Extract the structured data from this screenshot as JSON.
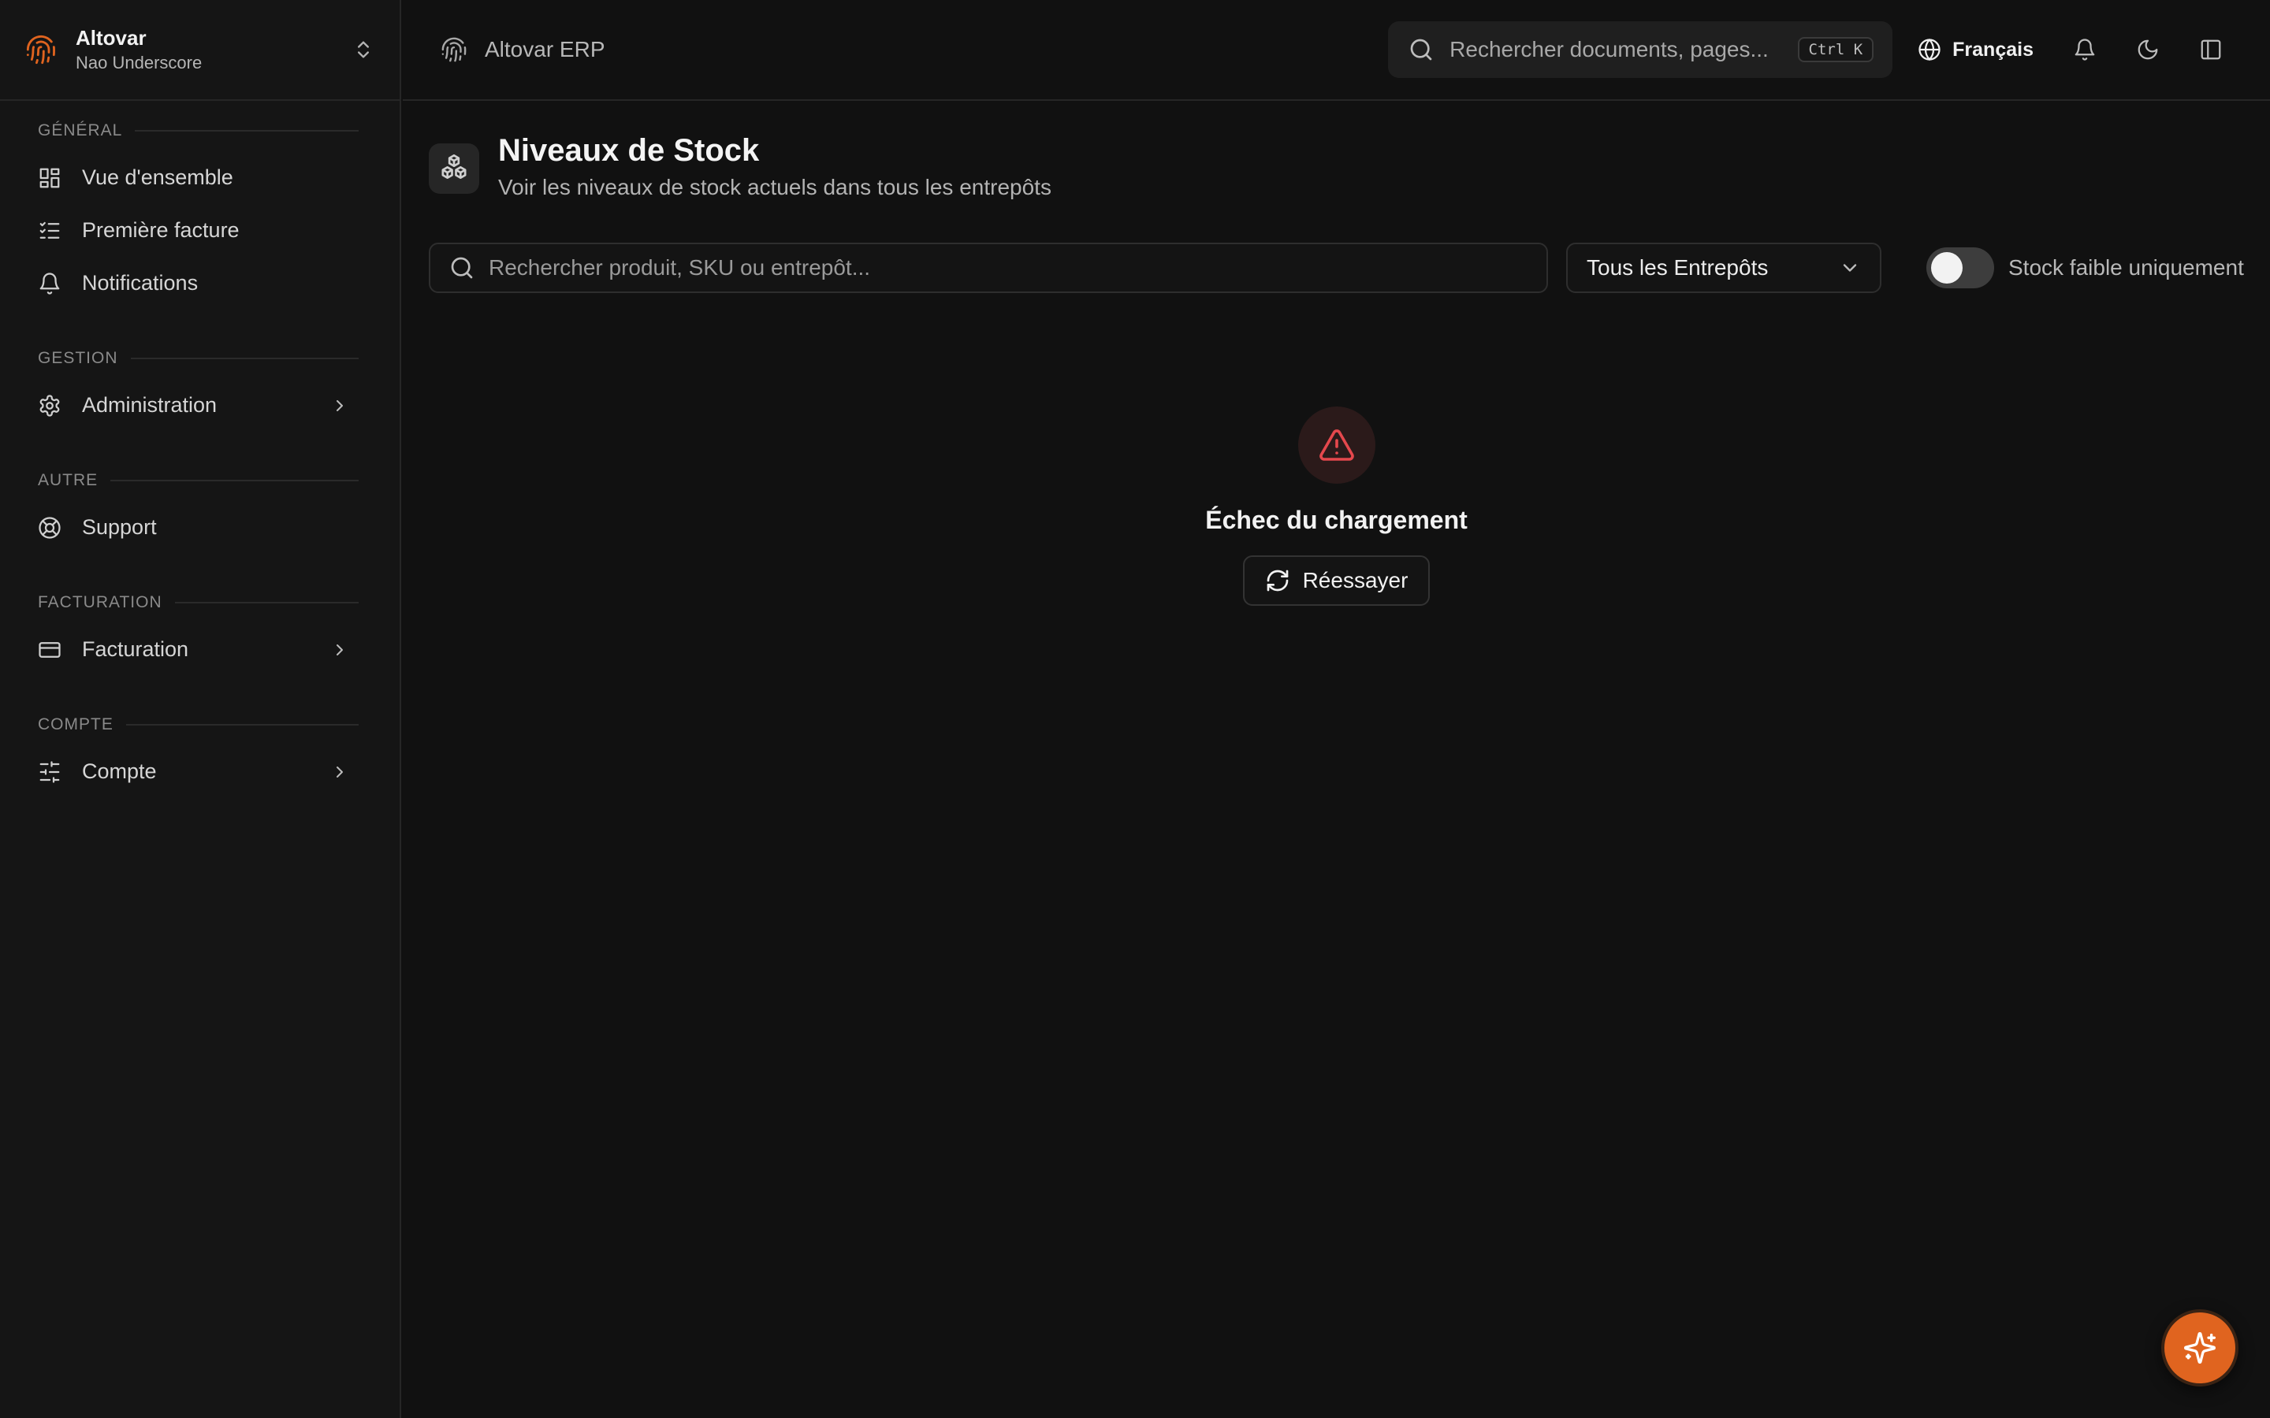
{
  "org": {
    "name": "Altovar",
    "subtitle": "Nao Underscore"
  },
  "sidebar": {
    "sections": [
      {
        "label": "GÉNÉRAL",
        "items": [
          {
            "label": "Vue d'ensemble",
            "icon": "dashboard-icon"
          },
          {
            "label": "Première facture",
            "icon": "checklist-icon"
          },
          {
            "label": "Notifications",
            "icon": "bell-icon"
          }
        ]
      },
      {
        "label": "GESTION",
        "items": [
          {
            "label": "Administration",
            "icon": "gear-icon",
            "expandable": true
          }
        ]
      },
      {
        "label": "AUTRE",
        "items": [
          {
            "label": "Support",
            "icon": "lifebuoy-icon"
          }
        ]
      },
      {
        "label": "FACTURATION",
        "items": [
          {
            "label": "Facturation",
            "icon": "credit-card-icon",
            "expandable": true
          }
        ]
      },
      {
        "label": "COMPTE",
        "items": [
          {
            "label": "Compte",
            "icon": "sliders-icon",
            "expandable": true
          }
        ]
      }
    ]
  },
  "topbar": {
    "brand": "Altovar ERP",
    "search_placeholder": "Rechercher documents, pages...",
    "shortcut": "Ctrl K",
    "language": "Français"
  },
  "page": {
    "title": "Niveaux de Stock",
    "subtitle": "Voir les niveaux de stock actuels dans tous les entrepôts"
  },
  "filters": {
    "search_placeholder": "Rechercher produit, SKU ou entrepôt...",
    "warehouse_selected": "Tous les Entrepôts",
    "low_stock_label": "Stock faible uniquement",
    "low_stock_enabled": false
  },
  "error": {
    "message": "Échec du chargement",
    "retry_label": "Réessayer"
  },
  "colors": {
    "accent": "#e0641f",
    "error": "#e5484d",
    "background": "#111111"
  }
}
